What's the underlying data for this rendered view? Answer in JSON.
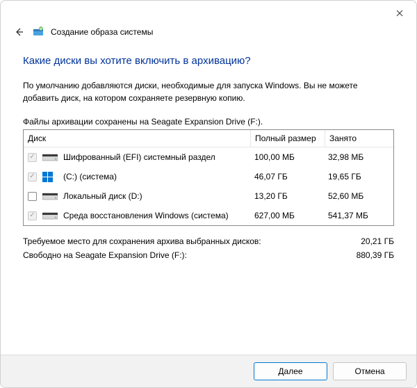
{
  "window": {
    "page_title": "Создание образа системы"
  },
  "heading": "Какие диски вы хотите включить в архивацию?",
  "description": "По умолчанию добавляются диски, необходимые для запуска Windows. Вы не можете добавить диск, на котором сохраняете резервную копию.",
  "saved_on": "Файлы архивации сохранены на Seagate Expansion Drive (F:).",
  "table": {
    "headers": {
      "disk": "Диск",
      "full_size": "Полный размер",
      "used": "Занято"
    },
    "rows": [
      {
        "checked": true,
        "enabled": false,
        "label": "Шифрованный (EFI) системный раздел",
        "size": "100,00 МБ",
        "used": "32,98 МБ",
        "icon": "partition"
      },
      {
        "checked": true,
        "enabled": false,
        "label": "(C:) (система)",
        "size": "46,07 ГБ",
        "used": "19,65 ГБ",
        "icon": "windows"
      },
      {
        "checked": false,
        "enabled": true,
        "label": "Локальный диск (D:)",
        "size": "13,20 ГБ",
        "used": "52,60 МБ",
        "icon": "drive"
      },
      {
        "checked": true,
        "enabled": false,
        "label": "Среда восстановления Windows (система)",
        "size": "627,00 МБ",
        "used": "541,37 МБ",
        "icon": "drive"
      }
    ]
  },
  "summary": {
    "required_label": "Требуемое место для сохранения архива выбранных дисков:",
    "required_value": "20,21 ГБ",
    "free_label": "Свободно на Seagate Expansion Drive (F:):",
    "free_value": "880,39 ГБ"
  },
  "buttons": {
    "next": "Далее",
    "cancel": "Отмена"
  }
}
